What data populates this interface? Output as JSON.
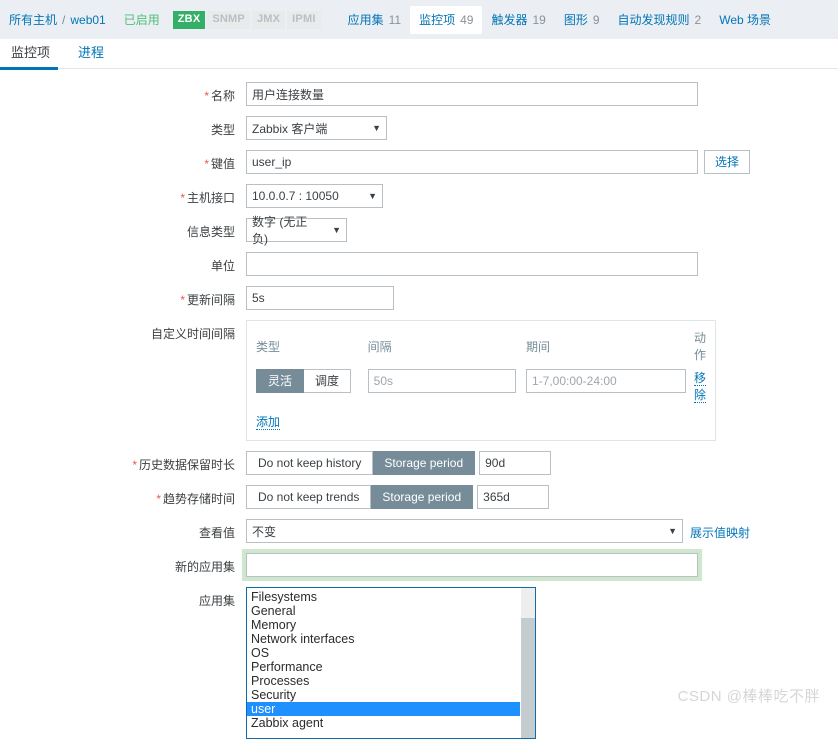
{
  "header": {
    "breadcrumb": {
      "all_hosts": "所有主机",
      "separator": "/",
      "host": "web01"
    },
    "status": "已启用",
    "badges": [
      {
        "label": "ZBX",
        "state": "active",
        "color": "#34af67"
      },
      {
        "label": "SNMP",
        "state": "inactive",
        "color": "#e8eaec"
      },
      {
        "label": "JMX",
        "state": "inactive",
        "color": "#e8eaec"
      },
      {
        "label": "IPMI",
        "state": "inactive",
        "color": "#e8eaec"
      }
    ],
    "nav": [
      {
        "label": "应用集",
        "count": "11",
        "active": false
      },
      {
        "label": "监控项",
        "count": "49",
        "active": true
      },
      {
        "label": "触发器",
        "count": "19",
        "active": false
      },
      {
        "label": "图形",
        "count": "9",
        "active": false
      },
      {
        "label": "自动发现规则",
        "count": "2",
        "active": false
      },
      {
        "label": "Web 场景",
        "count": "",
        "active": false
      }
    ]
  },
  "subtabs": [
    {
      "label": "监控项",
      "active": true
    },
    {
      "label": "进程",
      "active": false
    }
  ],
  "form": {
    "name": {
      "label": "名称",
      "required": true,
      "value": "用户连接数量",
      "placeholder": ""
    },
    "type": {
      "label": "类型",
      "required": false,
      "value": "Zabbix 客户端"
    },
    "key": {
      "label": "键值",
      "required": true,
      "value": "user_ip",
      "placeholder": "",
      "select_button": "选择"
    },
    "host_interface": {
      "label": "主机接口",
      "required": true,
      "value": "10.0.0.7 : 10050"
    },
    "info_type": {
      "label": "信息类型",
      "required": false,
      "value": "数字 (无正负)"
    },
    "units": {
      "label": "单位",
      "required": false,
      "value": "",
      "placeholder": ""
    },
    "update_interval": {
      "label": "更新间隔",
      "required": true,
      "value": "5s"
    },
    "custom_intervals": {
      "label": "自定义时间间隔",
      "columns": {
        "type": "类型",
        "interval": "间隔",
        "period": "期间",
        "action": "动作"
      },
      "rows": [
        {
          "type_options": [
            {
              "label": "灵活",
              "selected": true
            },
            {
              "label": "调度",
              "selected": false
            }
          ],
          "interval_value": "",
          "interval_placeholder": "50s",
          "period_value": "",
          "period_placeholder": "1-7,00:00-24:00",
          "action_label": "移除"
        }
      ],
      "add_label": "添加"
    },
    "history": {
      "label": "历史数据保留时长",
      "required": true,
      "options": [
        {
          "label": "Do not keep history",
          "selected": false
        },
        {
          "label": "Storage period",
          "selected": true
        }
      ],
      "value": "90d"
    },
    "trends": {
      "label": "趋势存储时间",
      "required": true,
      "options": [
        {
          "label": "Do not keep trends",
          "selected": false
        },
        {
          "label": "Storage period",
          "selected": true
        }
      ],
      "value": "365d"
    },
    "view_value": {
      "label": "查看值",
      "required": false,
      "value": "不变",
      "link_label": "展示值映射"
    },
    "new_application": {
      "label": "新的应用集",
      "required": false,
      "value": "",
      "placeholder": "",
      "focused": true,
      "focus_color": "#cfe6cf"
    },
    "applications": {
      "label": "应用集",
      "required": false,
      "options": [
        {
          "label": "Filesystems",
          "selected": false
        },
        {
          "label": "General",
          "selected": false
        },
        {
          "label": "Memory",
          "selected": false
        },
        {
          "label": "Network interfaces",
          "selected": false
        },
        {
          "label": "OS",
          "selected": false
        },
        {
          "label": "Performance",
          "selected": false
        },
        {
          "label": "Processes",
          "selected": false
        },
        {
          "label": "Security",
          "selected": false
        },
        {
          "label": "user",
          "selected": true
        },
        {
          "label": "Zabbix agent",
          "selected": false
        }
      ],
      "selection_color": "#1e90ff"
    }
  },
  "watermark": "CSDN @棒棒吃不胖",
  "icons": {
    "chevron_down": "▼",
    "required_marker": "*"
  }
}
